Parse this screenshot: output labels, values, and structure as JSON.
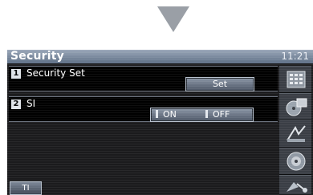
{
  "header": {
    "title": "Security",
    "clock": "11:21"
  },
  "rows": [
    {
      "number": "1",
      "label": "Security Set",
      "button_label": "Set"
    },
    {
      "number": "2",
      "label": "SI",
      "on_label": "ON",
      "off_label": "OFF"
    }
  ],
  "sidebar": {
    "icons": [
      "keypad-icon",
      "media-icon",
      "audio-icon",
      "speaker-icon",
      "satellite-icon"
    ]
  },
  "footer": {
    "ti_label": "TI"
  },
  "colors": {
    "header": "#5e6f86",
    "screen_bg": "#1b1b1d",
    "row_bg": "#000000"
  }
}
